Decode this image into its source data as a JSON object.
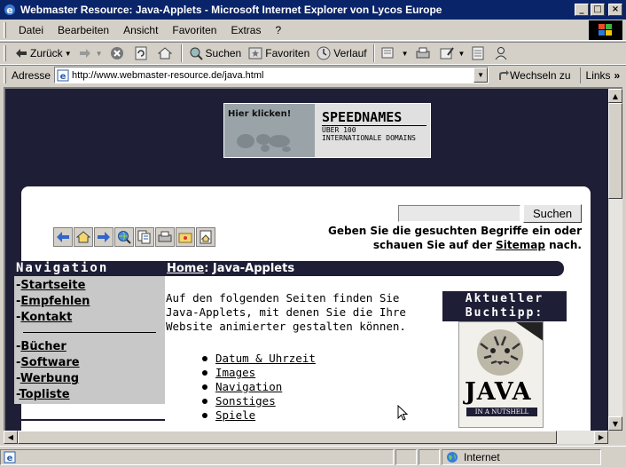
{
  "window": {
    "title": "Webmaster Resource: Java-Applets - Microsoft Internet Explorer von Lycos Europe",
    "min": "_",
    "max": "□",
    "close": "×"
  },
  "menu": [
    "Datei",
    "Bearbeiten",
    "Ansicht",
    "Favoriten",
    "Extras",
    "?"
  ],
  "toolbar": {
    "back": "Zurück",
    "search": "Suchen",
    "favorites": "Favoriten",
    "history": "Verlauf"
  },
  "address": {
    "label": "Adresse",
    "url": "http://www.webmaster-resource.de/java.html",
    "go": "Wechseln zu",
    "links": "Links",
    "links_more": "»"
  },
  "banner": {
    "cta": "Hier klicken!",
    "brand": "SPEEDNAMES",
    "tagline_1": "ÜBER 100",
    "tagline_2": "INTERNATIONALE DOMAINS"
  },
  "search": {
    "button": "Suchen",
    "value": "",
    "hint_line1": "Geben Sie die gesuchten Begriffe ein oder",
    "hint_pre": "schauen Sie auf der ",
    "hint_link": "Sitemap",
    "hint_post": " nach."
  },
  "nav_icons": [
    "arrow-left-icon",
    "home-icon",
    "arrow-right-icon",
    "globe-search-icon",
    "copy-icon",
    "print-icon",
    "folder-icon",
    "house-page-icon"
  ],
  "navigation": {
    "title": "Navigation",
    "items_top": [
      "Startseite",
      "Empfehlen",
      "Kontakt"
    ],
    "items_bottom": [
      "Bücher",
      "Software",
      "Werbung",
      "Topliste"
    ],
    "dash": "-"
  },
  "breadcrumb": {
    "home": "Home",
    "sep": ": ",
    "current": "Java-Applets"
  },
  "content": {
    "intro": "Auf den folgenden Seiten finden Sie Java-Applets, mit denen Sie die Ihre Website animierter gestalten können.",
    "categories": [
      "Datum & Uhrzeit",
      "Images",
      "Navigation",
      "Sonstiges",
      "Spiele"
    ]
  },
  "book": {
    "heading_1": "Aktueller",
    "heading_2": "Buchtipp:",
    "cover_title": "JAVA",
    "cover_sub": "IN A NUTSHELL"
  },
  "status": {
    "zone": "Internet"
  },
  "colors": {
    "titlebar": "#0a246a",
    "chrome": "#d4d0c8",
    "site_dark": "#1e1e36",
    "nav_bg": "#c8c8c8"
  }
}
